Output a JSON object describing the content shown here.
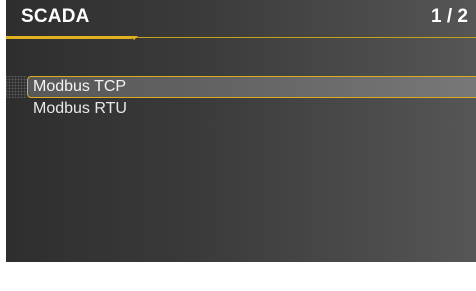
{
  "header": {
    "title": "SCADA",
    "page_indicator": "1 / 2"
  },
  "menu": {
    "items": [
      {
        "label": "Modbus TCP",
        "selected": true
      },
      {
        "label": "Modbus RTU",
        "selected": false
      }
    ]
  },
  "colors": {
    "accent": "#e0b21f",
    "text": "#ffffff",
    "background_dark": "#2e2e2e",
    "background_light": "#565656"
  }
}
